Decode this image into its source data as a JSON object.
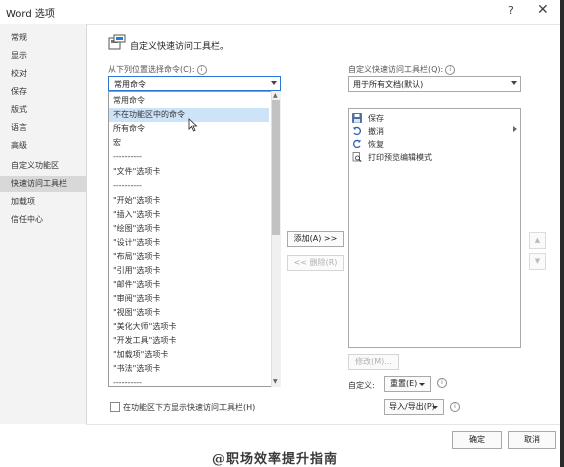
{
  "window": {
    "title": "Word 选项",
    "help": "?",
    "close": "✕"
  },
  "sidebar": {
    "items": [
      {
        "label": "常规"
      },
      {
        "label": "显示"
      },
      {
        "label": "校对"
      },
      {
        "label": "保存"
      },
      {
        "label": "版式"
      },
      {
        "label": "语言"
      },
      {
        "label": "高级"
      },
      {
        "label": "自定义功能区"
      },
      {
        "label": "快速访问工具栏",
        "selected": true
      },
      {
        "label": "加载项"
      },
      {
        "label": "信任中心"
      }
    ]
  },
  "heading": "自定义快速访问工具栏。",
  "left_panel": {
    "choose_label": "从下列位置选择命令(C):",
    "info_glyph": "i",
    "select_value": "常用命令",
    "options": [
      "常用命令",
      "不在功能区中的命令",
      "所有命令",
      "宏",
      "----------",
      "\"文件\"选项卡",
      "----------",
      "\"开始\"选项卡",
      "\"插入\"选项卡",
      "\"绘图\"选项卡",
      "\"设计\"选项卡",
      "\"布局\"选项卡",
      "\"引用\"选项卡",
      "\"邮件\"选项卡",
      "\"审阅\"选项卡",
      "\"视图\"选项卡",
      "\"美化大师\"选项卡",
      "\"开发工具\"选项卡",
      "\"加载项\"选项卡",
      "\"书法\"选项卡",
      "----------"
    ],
    "highlighted_option": "不在功能区中的命令",
    "show_below_label": "在功能区下方显示快速访问工具栏(H)",
    "show_below_checked": false
  },
  "middle": {
    "add_label": "添加(A) >>",
    "remove_label": "<< 删除(R)"
  },
  "right_panel": {
    "customize_label": "自定义快速访问工具栏(Q):",
    "doc_select_value": "用于所有文档(默认)",
    "items": [
      {
        "label": "保存",
        "icon": "save-icon"
      },
      {
        "label": "撤消",
        "icon": "undo-icon"
      },
      {
        "label": "恢复",
        "icon": "redo-icon"
      },
      {
        "label": "打印预览编辑模式",
        "icon": "print-preview-icon"
      }
    ],
    "modify_label": "修改(M)...",
    "customize_text": "自定义:",
    "reset_label": "重置(E)",
    "import_export_label": "导入/导出(P)",
    "move_up": "▲",
    "move_down": "▼"
  },
  "footer": {
    "ok_label": "确定",
    "cancel_label": "取消"
  },
  "watermark": "@职场效率提升指南",
  "colors": {
    "accent": "#2b78d4",
    "highlight": "#cde3f8",
    "sidebar_bg": "#f3f3f3",
    "sidebar_selected": "#d8d8d8"
  }
}
